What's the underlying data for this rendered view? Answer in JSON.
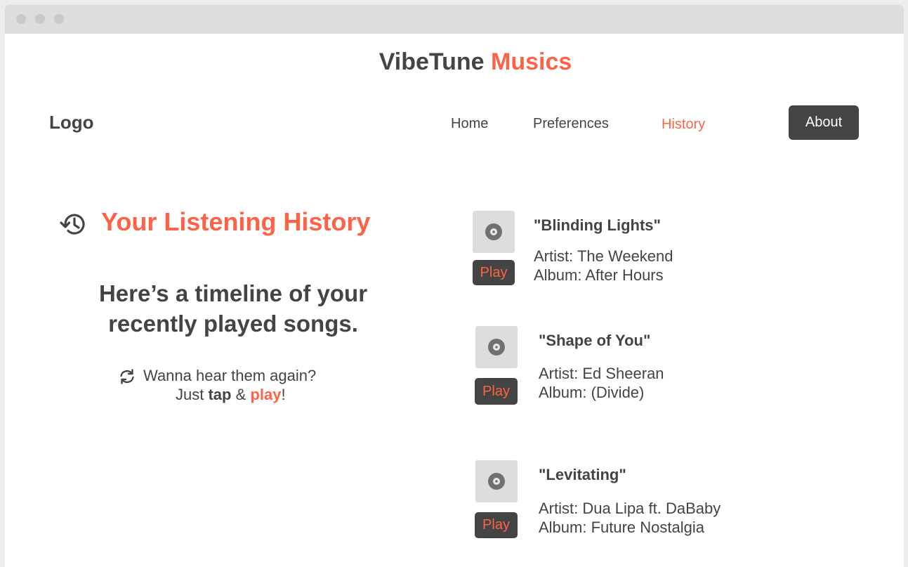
{
  "site": {
    "title_main": "VibeTune",
    "title_accent": "Musics"
  },
  "nav": {
    "logo": "Logo",
    "links": [
      {
        "label": "Home",
        "active": false
      },
      {
        "label": "Preferences",
        "active": false
      },
      {
        "label": "History",
        "active": true
      }
    ],
    "about_label": "About"
  },
  "intro": {
    "heading": "Your Listening History",
    "heading_icon": "history-icon",
    "subheading": "Here’s a timeline of your recently played songs.",
    "hint_icon": "sync-icon",
    "hint_line1": "Wanna hear them again?",
    "hint_just": "Just",
    "hint_tap": "tap",
    "hint_amp": "&",
    "hint_play": "play",
    "hint_end": "!"
  },
  "songs": [
    {
      "title": "\"Blinding Lights\"",
      "artist": "Artist: The Weekend",
      "album": "Album: After Hours",
      "play_label": "Play"
    },
    {
      "title": "\"Shape of You\"",
      "artist": "Artist: Ed Sheeran",
      "album": "Album: (Divide)",
      "play_label": "Play"
    },
    {
      "title": "\"Levitating\"",
      "artist": "Artist: Dua Lipa ft. DaBaby",
      "album": "Album: Future Nostalgia",
      "play_label": "Play"
    }
  ],
  "colors": {
    "accent": "#ff6347",
    "text": "#444444",
    "button_dark": "#444444",
    "art_bg": "#dddddd"
  }
}
